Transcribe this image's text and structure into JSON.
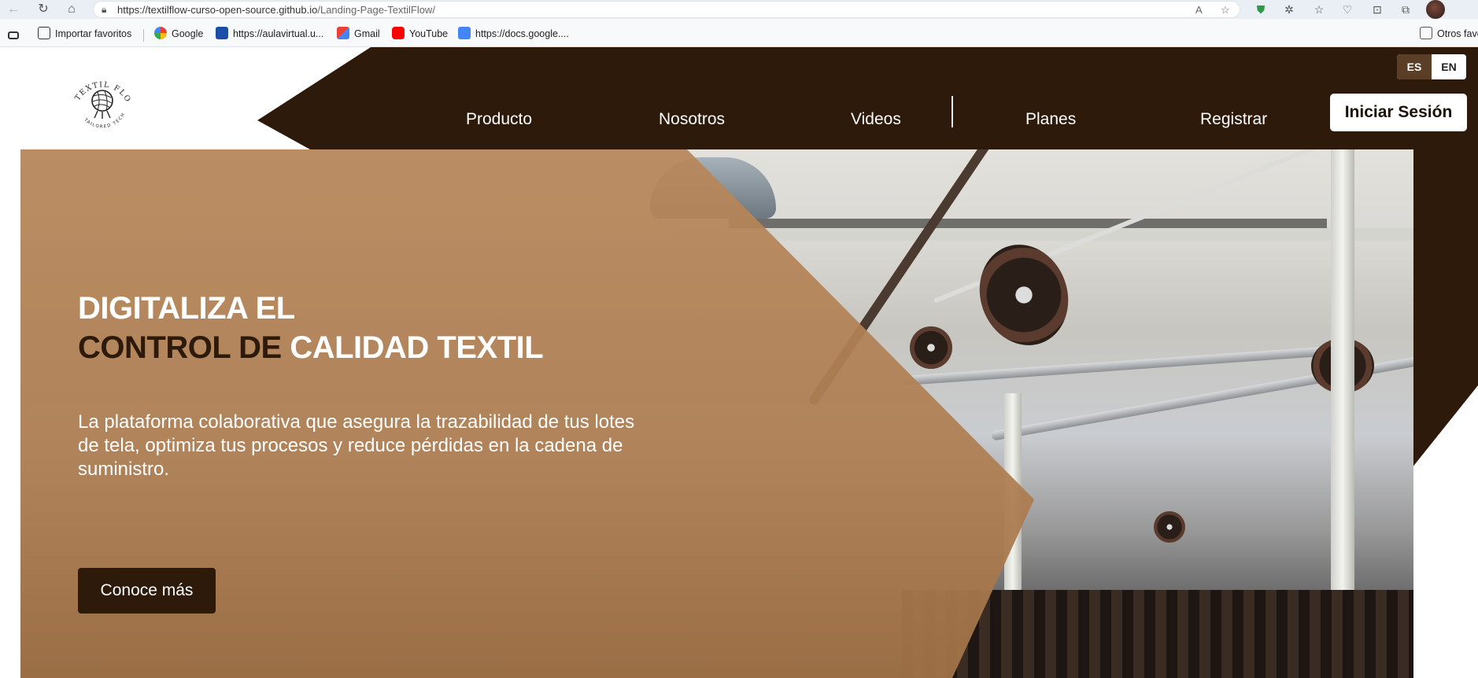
{
  "browser": {
    "url_prefix": "https://textilflow-curso-open-source.github.io",
    "url_path": "/Landing-Page-TextilFlow/",
    "bookmarks": [
      {
        "label": "Importar favoritos"
      },
      {
        "label": "Google"
      },
      {
        "label": "https://aulavirtual.u..."
      },
      {
        "label": "Gmail"
      },
      {
        "label": "YouTube"
      },
      {
        "label": "https://docs.google...."
      }
    ],
    "other_bookmarks": "Otros favo"
  },
  "header": {
    "logo_text_top": "TEXTIL FLOW",
    "logo_text_bottom": "TAILORED TECH",
    "lang": {
      "es": "ES",
      "en": "EN"
    },
    "nav": [
      {
        "label": "Producto"
      },
      {
        "label": "Nosotros"
      },
      {
        "label": "Videos"
      },
      {
        "label": "Planes"
      },
      {
        "label": "Registrar"
      }
    ],
    "login": "Iniciar Sesión"
  },
  "hero": {
    "title_line1": "DIGITALIZA EL",
    "title_line2_dark": "CONTROL DE ",
    "title_line2_light": "CALIDAD TEXTIL",
    "subtitle": "La plataforma colaborativa que asegura la trazabilidad de tus lotes de tela, optimiza tus procesos y reduce pérdidas en la cadena de suministro.",
    "cta": "Conoce más"
  },
  "colors": {
    "brand_dark": "#2e1a0a",
    "brand_tan": "#b8875a"
  }
}
